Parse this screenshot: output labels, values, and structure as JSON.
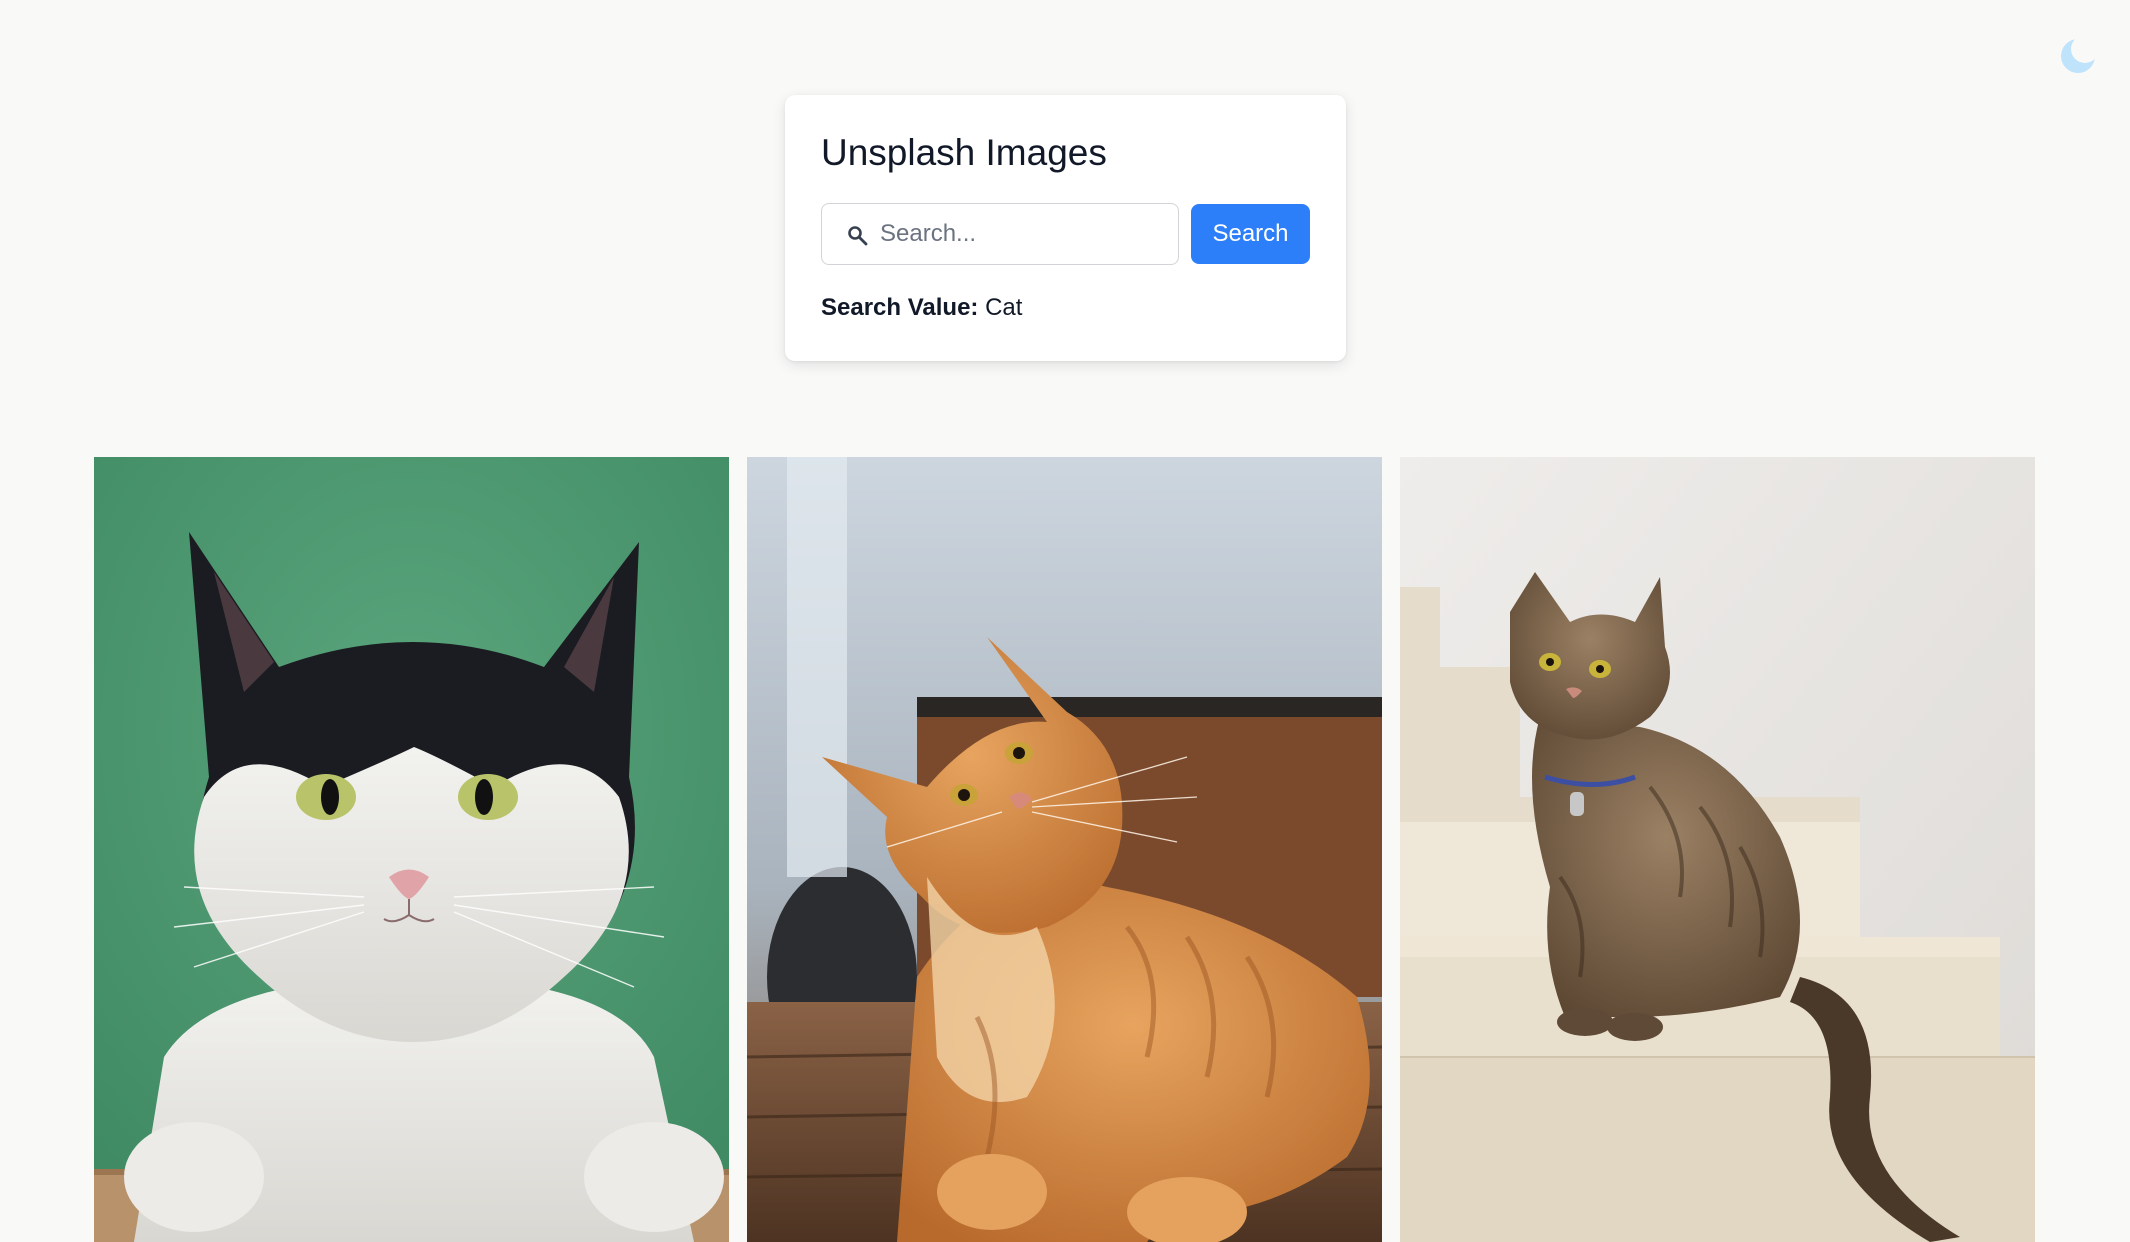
{
  "app": {
    "title": "Unsplash Images"
  },
  "theme_toggle": {
    "icon": "moon-icon",
    "color": "#bfe3fb"
  },
  "search": {
    "placeholder": "Search...",
    "value": "",
    "button_label": "Search",
    "icon": "search-icon"
  },
  "search_value": {
    "label": "Search Value:",
    "value": "Cat"
  },
  "colors": {
    "accent": "#2d7ff9",
    "background": "#f9f9f8",
    "card": "#ffffff",
    "text": "#111827"
  },
  "gallery": {
    "images": [
      {
        "subject": "black-and-white cat on green background"
      },
      {
        "subject": "orange tabby cat lying on wooden floor"
      },
      {
        "subject": "tabby cat sitting on white stairs"
      }
    ]
  }
}
